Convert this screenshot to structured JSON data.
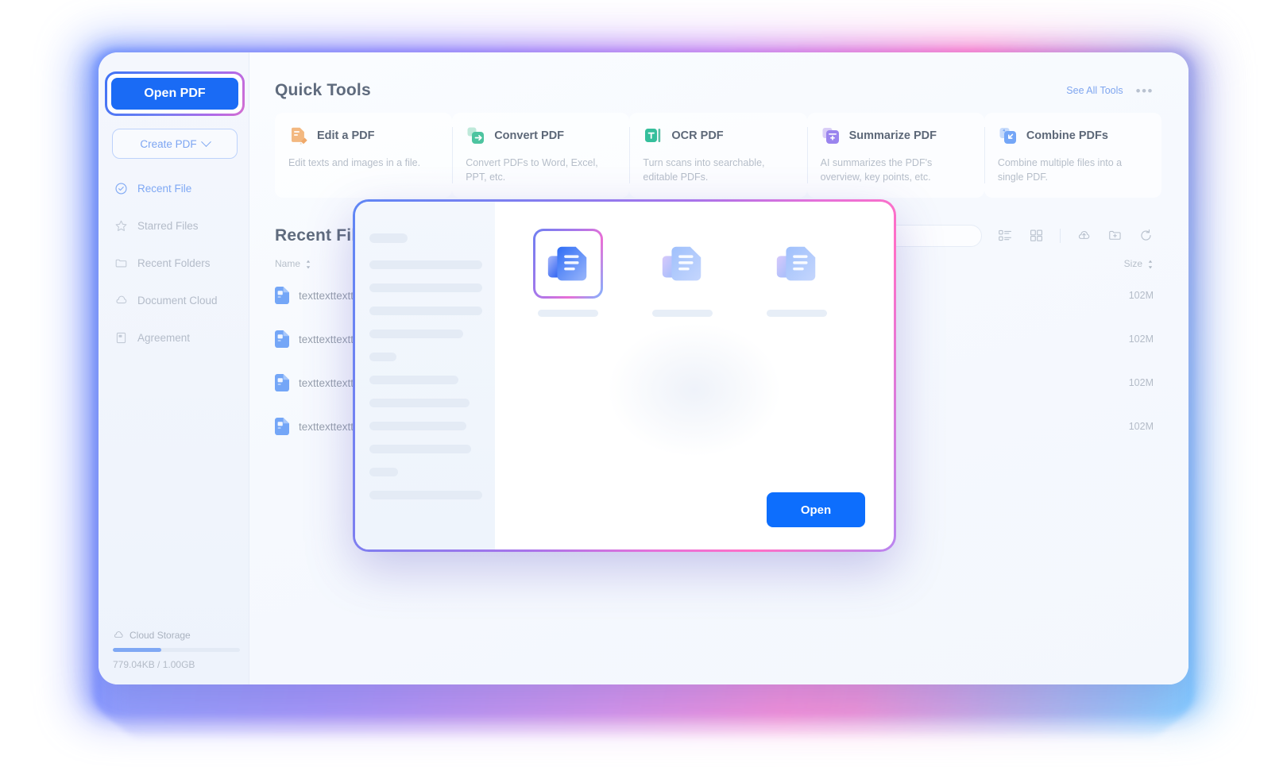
{
  "sidebar": {
    "open_pdf_label": "Open PDF",
    "create_pdf_label": "Create PDF",
    "items": [
      {
        "label": "Recent File",
        "icon": "clock-check-icon",
        "active": true
      },
      {
        "label": "Starred Files",
        "icon": "star-icon",
        "active": false
      },
      {
        "label": "Recent Folders",
        "icon": "folder-icon",
        "active": false
      },
      {
        "label": "Document Cloud",
        "icon": "cloud-icon",
        "active": false
      },
      {
        "label": "Agreement",
        "icon": "document-icon",
        "active": false
      }
    ],
    "storage": {
      "label": "Cloud Storage",
      "icon": "cloud-icon",
      "used_text": "779.04KB / 1.00GB",
      "percent": 38
    }
  },
  "quick_tools": {
    "title": "Quick Tools",
    "see_all_label": "See All Tools",
    "more_label": "•••",
    "cards": [
      {
        "name": "Edit a PDF",
        "desc": "Edit texts and images in a file.",
        "icon": "edit-pdf-icon",
        "color": "#f2b37a"
      },
      {
        "name": "Convert PDF",
        "desc": "Convert PDFs to Word, Excel, PPT, etc.",
        "icon": "convert-pdf-icon",
        "color": "#5ec9a7"
      },
      {
        "name": "OCR PDF",
        "desc": "Turn scans into searchable, editable PDFs.",
        "icon": "ocr-pdf-icon",
        "color": "#3fc1a0"
      },
      {
        "name": "Summarize PDF",
        "desc": "AI summarizes the PDF's overview, key points, etc.",
        "icon": "summarize-pdf-icon",
        "color": "#8f7cf0"
      },
      {
        "name": "Combine PDFs",
        "desc": "Combine multiple files into a single PDF.",
        "icon": "combine-pdfs-icon",
        "color": "#6b9cf8"
      }
    ]
  },
  "recent": {
    "title": "Recent File",
    "search_placeholder": "",
    "toolbar_icons": [
      "list-view-icon",
      "grid-view-icon",
      "cloud-upload-icon",
      "new-folder-icon",
      "refresh-icon"
    ],
    "columns": {
      "name": "Name",
      "size": "Size"
    },
    "rows": [
      {
        "name": "texttexttexttext",
        "size": "102M",
        "icon": "pdf-file-icon"
      },
      {
        "name": "texttexttexttext",
        "size": "102M",
        "icon": "pdf-file-icon"
      },
      {
        "name": "texttexttexttext",
        "size": "102M",
        "icon": "pdf-file-icon"
      },
      {
        "name": "texttexttexttext",
        "size": "102M",
        "icon": "pdf-file-icon"
      }
    ]
  },
  "modal": {
    "open_label": "Open",
    "thumbnails": [
      {
        "icon": "pdf-doc-thumb-icon",
        "selected": true
      },
      {
        "icon": "pdf-doc-thumb-icon",
        "selected": false
      },
      {
        "icon": "pdf-doc-thumb-icon",
        "selected": false
      }
    ]
  },
  "colors": {
    "primary_blue": "#1a6bf5",
    "modal_open_blue": "#0d6efd",
    "link_blue": "#7fa6ef",
    "accent_gradient_start": "#5f86f5",
    "accent_gradient_end": "#ff6fc6"
  }
}
